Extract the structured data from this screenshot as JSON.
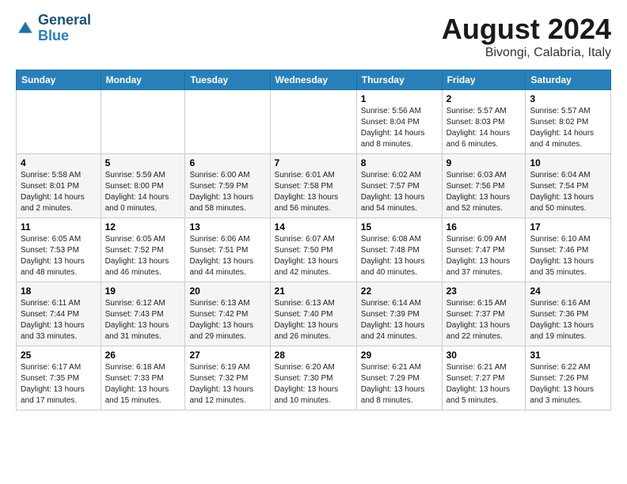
{
  "header": {
    "logo_line1": "General",
    "logo_line2": "Blue",
    "title": "August 2024",
    "subtitle": "Bivongi, Calabria, Italy"
  },
  "weekdays": [
    "Sunday",
    "Monday",
    "Tuesday",
    "Wednesday",
    "Thursday",
    "Friday",
    "Saturday"
  ],
  "weeks": [
    [
      {
        "day": "",
        "info": ""
      },
      {
        "day": "",
        "info": ""
      },
      {
        "day": "",
        "info": ""
      },
      {
        "day": "",
        "info": ""
      },
      {
        "day": "1",
        "info": "Sunrise: 5:56 AM\nSunset: 8:04 PM\nDaylight: 14 hours\nand 8 minutes."
      },
      {
        "day": "2",
        "info": "Sunrise: 5:57 AM\nSunset: 8:03 PM\nDaylight: 14 hours\nand 6 minutes."
      },
      {
        "day": "3",
        "info": "Sunrise: 5:57 AM\nSunset: 8:02 PM\nDaylight: 14 hours\nand 4 minutes."
      }
    ],
    [
      {
        "day": "4",
        "info": "Sunrise: 5:58 AM\nSunset: 8:01 PM\nDaylight: 14 hours\nand 2 minutes."
      },
      {
        "day": "5",
        "info": "Sunrise: 5:59 AM\nSunset: 8:00 PM\nDaylight: 14 hours\nand 0 minutes."
      },
      {
        "day": "6",
        "info": "Sunrise: 6:00 AM\nSunset: 7:59 PM\nDaylight: 13 hours\nand 58 minutes."
      },
      {
        "day": "7",
        "info": "Sunrise: 6:01 AM\nSunset: 7:58 PM\nDaylight: 13 hours\nand 56 minutes."
      },
      {
        "day": "8",
        "info": "Sunrise: 6:02 AM\nSunset: 7:57 PM\nDaylight: 13 hours\nand 54 minutes."
      },
      {
        "day": "9",
        "info": "Sunrise: 6:03 AM\nSunset: 7:56 PM\nDaylight: 13 hours\nand 52 minutes."
      },
      {
        "day": "10",
        "info": "Sunrise: 6:04 AM\nSunset: 7:54 PM\nDaylight: 13 hours\nand 50 minutes."
      }
    ],
    [
      {
        "day": "11",
        "info": "Sunrise: 6:05 AM\nSunset: 7:53 PM\nDaylight: 13 hours\nand 48 minutes."
      },
      {
        "day": "12",
        "info": "Sunrise: 6:05 AM\nSunset: 7:52 PM\nDaylight: 13 hours\nand 46 minutes."
      },
      {
        "day": "13",
        "info": "Sunrise: 6:06 AM\nSunset: 7:51 PM\nDaylight: 13 hours\nand 44 minutes."
      },
      {
        "day": "14",
        "info": "Sunrise: 6:07 AM\nSunset: 7:50 PM\nDaylight: 13 hours\nand 42 minutes."
      },
      {
        "day": "15",
        "info": "Sunrise: 6:08 AM\nSunset: 7:48 PM\nDaylight: 13 hours\nand 40 minutes."
      },
      {
        "day": "16",
        "info": "Sunrise: 6:09 AM\nSunset: 7:47 PM\nDaylight: 13 hours\nand 37 minutes."
      },
      {
        "day": "17",
        "info": "Sunrise: 6:10 AM\nSunset: 7:46 PM\nDaylight: 13 hours\nand 35 minutes."
      }
    ],
    [
      {
        "day": "18",
        "info": "Sunrise: 6:11 AM\nSunset: 7:44 PM\nDaylight: 13 hours\nand 33 minutes."
      },
      {
        "day": "19",
        "info": "Sunrise: 6:12 AM\nSunset: 7:43 PM\nDaylight: 13 hours\nand 31 minutes."
      },
      {
        "day": "20",
        "info": "Sunrise: 6:13 AM\nSunset: 7:42 PM\nDaylight: 13 hours\nand 29 minutes."
      },
      {
        "day": "21",
        "info": "Sunrise: 6:13 AM\nSunset: 7:40 PM\nDaylight: 13 hours\nand 26 minutes."
      },
      {
        "day": "22",
        "info": "Sunrise: 6:14 AM\nSunset: 7:39 PM\nDaylight: 13 hours\nand 24 minutes."
      },
      {
        "day": "23",
        "info": "Sunrise: 6:15 AM\nSunset: 7:37 PM\nDaylight: 13 hours\nand 22 minutes."
      },
      {
        "day": "24",
        "info": "Sunrise: 6:16 AM\nSunset: 7:36 PM\nDaylight: 13 hours\nand 19 minutes."
      }
    ],
    [
      {
        "day": "25",
        "info": "Sunrise: 6:17 AM\nSunset: 7:35 PM\nDaylight: 13 hours\nand 17 minutes."
      },
      {
        "day": "26",
        "info": "Sunrise: 6:18 AM\nSunset: 7:33 PM\nDaylight: 13 hours\nand 15 minutes."
      },
      {
        "day": "27",
        "info": "Sunrise: 6:19 AM\nSunset: 7:32 PM\nDaylight: 13 hours\nand 12 minutes."
      },
      {
        "day": "28",
        "info": "Sunrise: 6:20 AM\nSunset: 7:30 PM\nDaylight: 13 hours\nand 10 minutes."
      },
      {
        "day": "29",
        "info": "Sunrise: 6:21 AM\nSunset: 7:29 PM\nDaylight: 13 hours\nand 8 minutes."
      },
      {
        "day": "30",
        "info": "Sunrise: 6:21 AM\nSunset: 7:27 PM\nDaylight: 13 hours\nand 5 minutes."
      },
      {
        "day": "31",
        "info": "Sunrise: 6:22 AM\nSunset: 7:26 PM\nDaylight: 13 hours\nand 3 minutes."
      }
    ]
  ]
}
